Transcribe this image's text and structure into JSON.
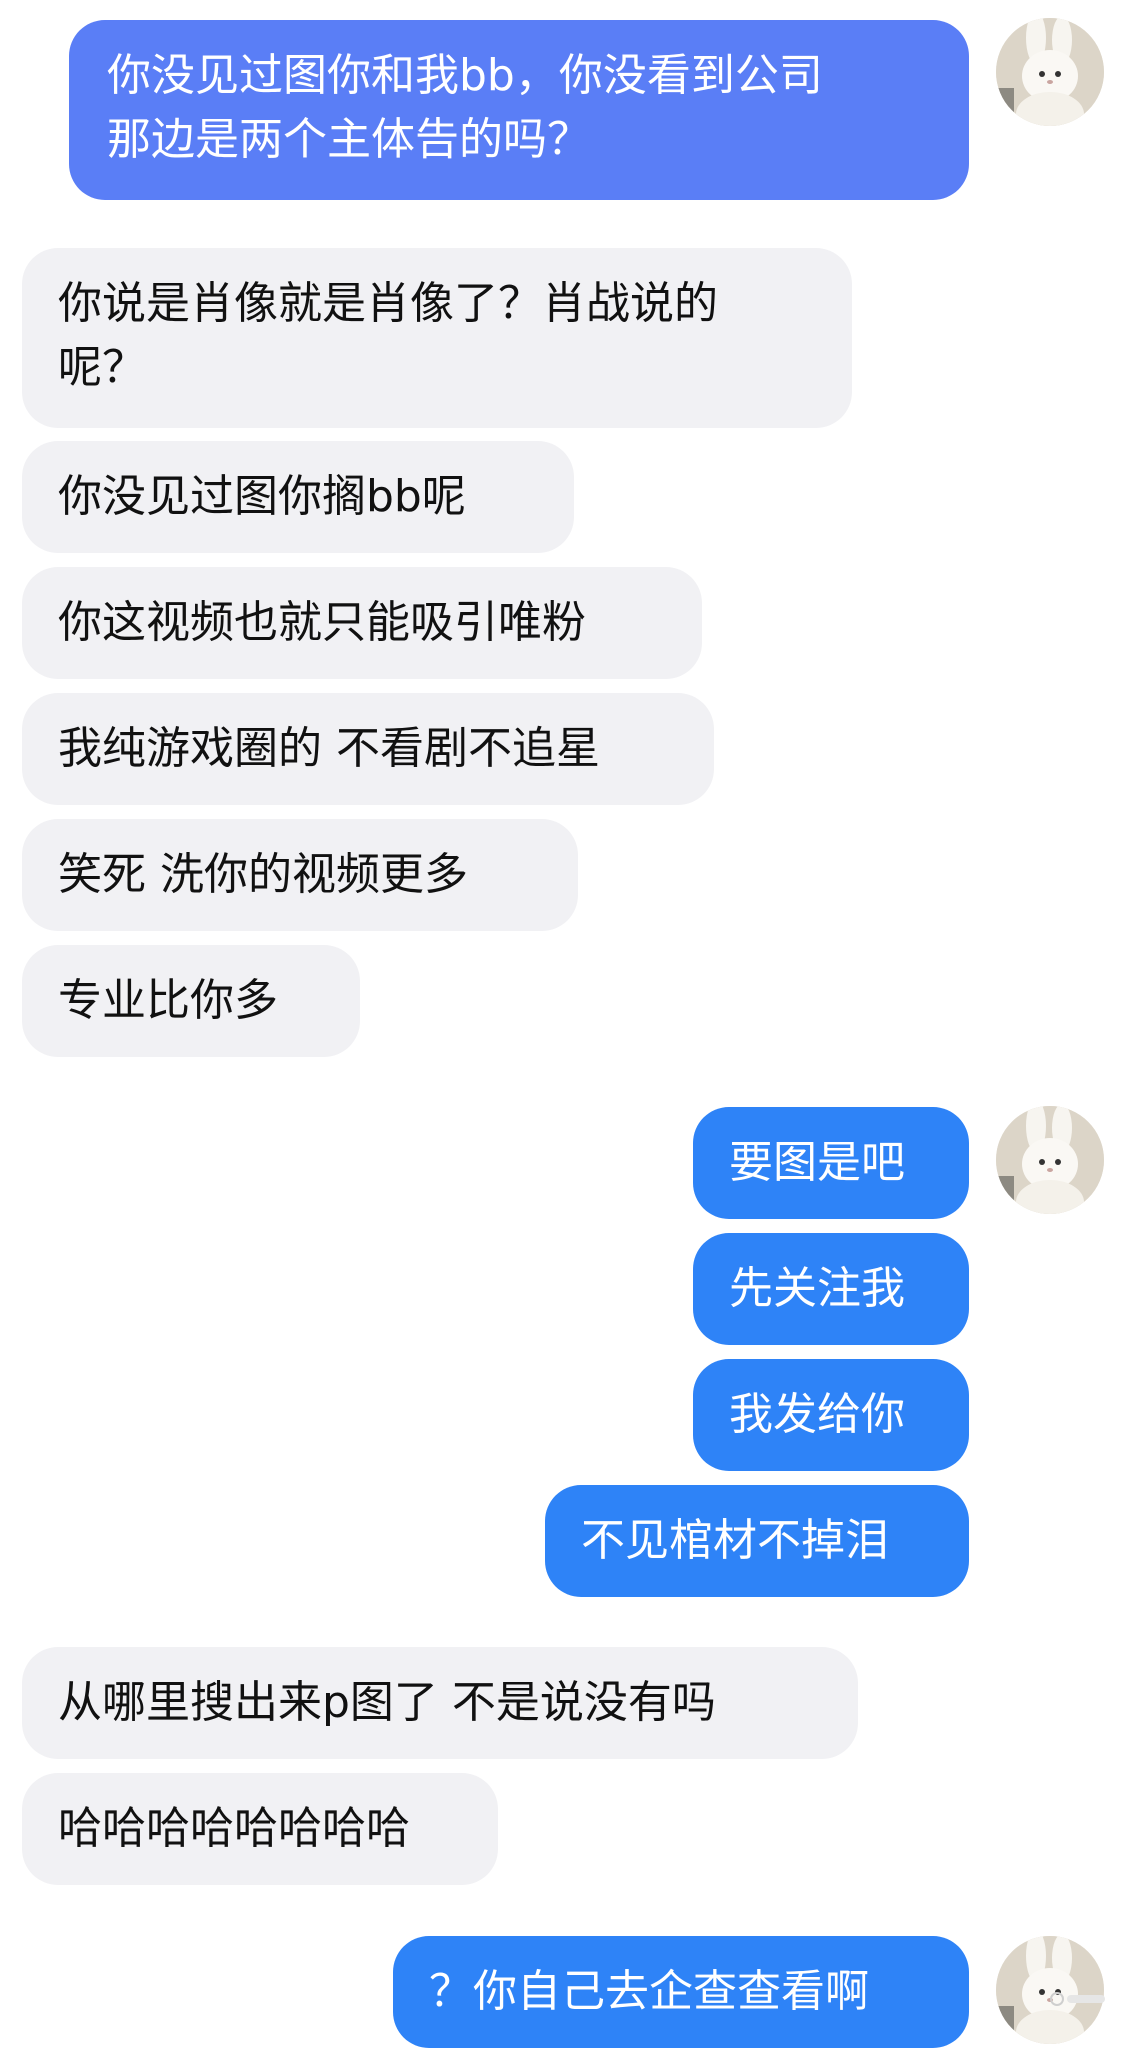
{
  "chat": {
    "messages": [
      {
        "side": "outgoing",
        "text": "你没见过图你和我bb，你没看到公司\n那边是两个主体告的吗？"
      },
      {
        "side": "incoming",
        "text": "你说是肖像就是肖像了？肖战说的\n呢？"
      },
      {
        "side": "incoming",
        "text": "你没见过图你搁bb呢"
      },
      {
        "side": "incoming",
        "text": "你这视频也就只能吸引唯粉"
      },
      {
        "side": "incoming",
        "text": "我纯游戏圈的 不看剧不追星"
      },
      {
        "side": "incoming",
        "text": "笑死 洗你的视频更多"
      },
      {
        "side": "incoming",
        "text": "专业比你多"
      },
      {
        "side": "outgoing",
        "text": "要图是吧"
      },
      {
        "side": "outgoing",
        "text": "先关注我"
      },
      {
        "side": "outgoing",
        "text": "我发给你"
      },
      {
        "side": "outgoing",
        "text": "不见棺材不掉泪"
      },
      {
        "side": "incoming",
        "text": "从哪里搜出来p图了 不是说没有吗"
      },
      {
        "side": "incoming",
        "text": "哈哈哈哈哈哈哈哈"
      },
      {
        "side": "outgoing",
        "text": "？你自己去企查查看啊"
      }
    ]
  },
  "avatar_icon": "bunny-plush-avatar-icon",
  "colors": {
    "outgoing_first": "#5a7ef6",
    "outgoing": "#2e83f7",
    "incoming": "#f1f1f4",
    "avatar_bg": "#e9e3d6"
  }
}
